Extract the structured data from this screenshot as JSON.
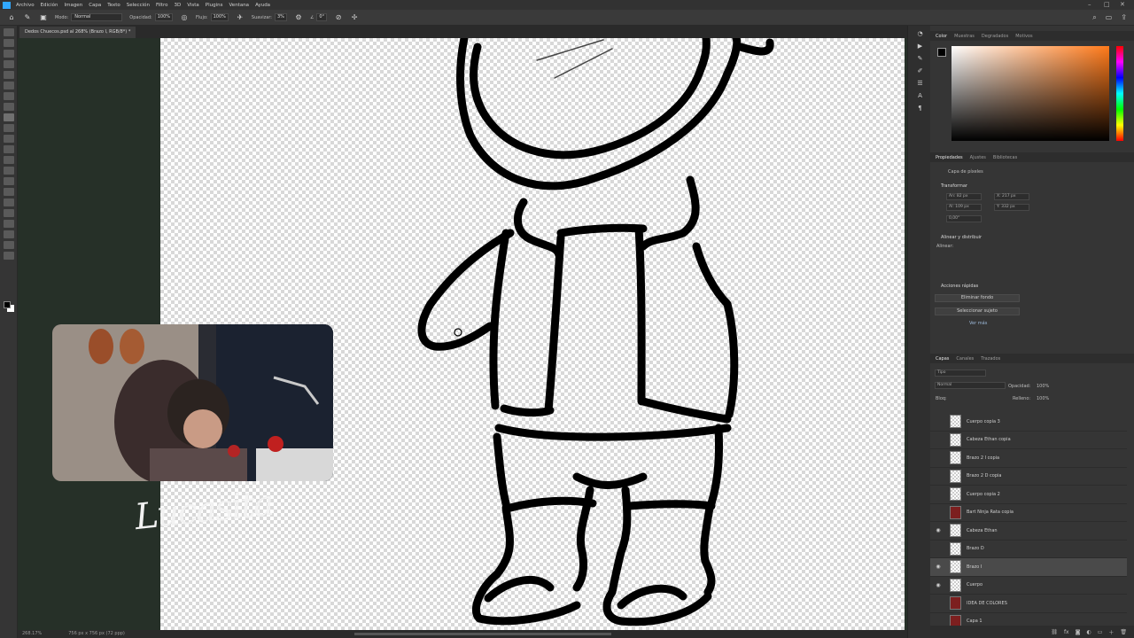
{
  "menu": [
    "Archivo",
    "Edición",
    "Imagen",
    "Capa",
    "Texto",
    "Selección",
    "Filtro",
    "3D",
    "Vista",
    "Plugins",
    "Ventana",
    "Ayuda"
  ],
  "options": {
    "mode_label": "Modo:",
    "mode_value": "Normal",
    "opacity_label": "Opacidad:",
    "opacity_value": "100%",
    "flow_label": "Flujo:",
    "flow_value": "100%",
    "smoothing_label": "Suavizar:",
    "smoothing_value": "3%",
    "angle_value": "0°"
  },
  "document": {
    "tab_title": "Dedos Chuecos.psd al 268% (Brazo I, RGB/8*) *",
    "zoom_status": "268.17%",
    "size_status": "756 px x 756 px (72 ppp)"
  },
  "overlay": {
    "watermark": "Lucasita"
  },
  "color_panel": {
    "tabs": [
      "Color",
      "Muestras",
      "Degradados",
      "Motivos"
    ],
    "hue_color": "#ff7a1a"
  },
  "properties_panel": {
    "tabs": [
      "Propiedades",
      "Ajustes",
      "Bibliotecas"
    ],
    "layer_kind": "Capa de píxeles",
    "transform_heading": "Transformar",
    "w_field": "An: 82 px",
    "x_field": "X: 217 px",
    "h_field": "Al: 109 px",
    "y_field": "Y: 332 px",
    "angle_field": "0,00°",
    "align_heading": "Alinear y distribuir",
    "align_sub": "Alinear:",
    "quick_actions_heading": "Acciones rápidas",
    "remove_bg_button": "Eliminar fondo",
    "select_subject_button": "Seleccionar sujeto",
    "more_link": "Ver más"
  },
  "layers_panel": {
    "tabs": [
      "Capas",
      "Canales",
      "Trazados"
    ],
    "filter_label": "Tipo",
    "blend_mode": "Normal",
    "opacity_label": "Opacidad:",
    "opacity_value": "100%",
    "lock_label": "Bloq:",
    "fill_label": "Relleno:",
    "fill_value": "100%",
    "layers": [
      {
        "name": "Cuerpo copia 3",
        "visible": false,
        "thumb": "white",
        "selected": false
      },
      {
        "name": "Cabeza Ethan copia",
        "visible": false,
        "thumb": "white",
        "selected": false
      },
      {
        "name": "Brazo 2 I copia",
        "visible": false,
        "thumb": "white",
        "selected": false
      },
      {
        "name": "Brazo 2 D copia",
        "visible": false,
        "thumb": "white",
        "selected": false
      },
      {
        "name": "Cuerpo copia 2",
        "visible": false,
        "thumb": "white",
        "selected": false
      },
      {
        "name": "Bart Ninja Rata copia",
        "visible": false,
        "thumb": "red",
        "selected": false
      },
      {
        "name": "Cabeza Ethan",
        "visible": true,
        "thumb": "white",
        "selected": false
      },
      {
        "name": "Brazo D",
        "visible": false,
        "thumb": "white",
        "selected": false
      },
      {
        "name": "Brazo I",
        "visible": true,
        "thumb": "white",
        "selected": true
      },
      {
        "name": "Cuerpo",
        "visible": true,
        "thumb": "white",
        "selected": false
      },
      {
        "name": "IDEA DE COLORES",
        "visible": false,
        "thumb": "red",
        "selected": false
      },
      {
        "name": "Capa 1",
        "visible": false,
        "thumb": "red",
        "selected": false
      }
    ]
  }
}
